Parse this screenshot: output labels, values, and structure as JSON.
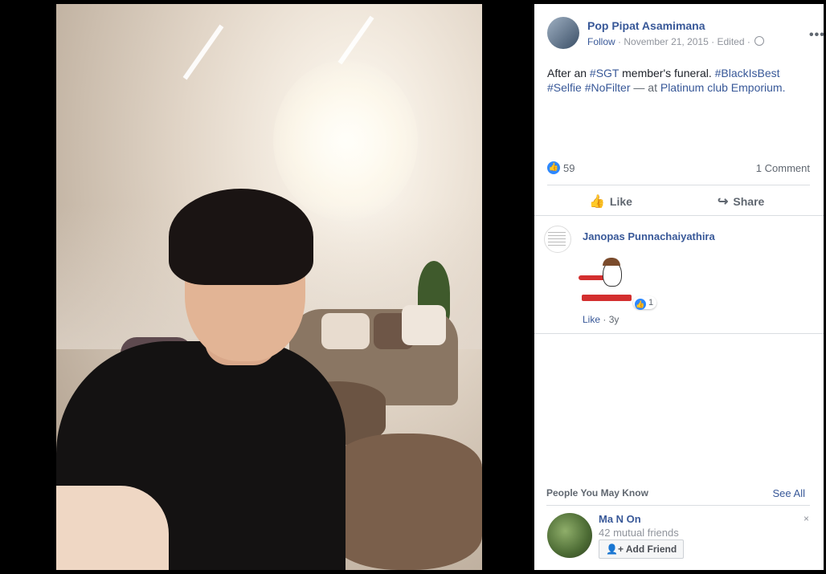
{
  "post": {
    "author": "Pop Pipat Asamimana",
    "follow_label": "Follow",
    "date": "November 21, 2015",
    "edited": "Edited",
    "privacy_icon": "globe-icon",
    "more_label": "•••",
    "caption_prefix": "After an ",
    "tag_sgt": "#SGT",
    "caption_mid": " member's funeral. ",
    "tag_blackisbest": "#BlackIsBest",
    "tag_selfie": "#Selfie",
    "tag_nofilter": "#NoFilter",
    "at_text": " — at ",
    "place": "Platinum club Emporium."
  },
  "reactions": {
    "like_count": "59",
    "comment_count": "1 Comment"
  },
  "actions": {
    "like_label": "Like",
    "share_label": "Share"
  },
  "comment": {
    "author": "Janopas Punnachaiyathira",
    "reaction_count": "1",
    "like_label": "Like",
    "time": "3y"
  },
  "people_you_may_know": {
    "title": "People You May Know",
    "see_all": "See All",
    "suggestion": {
      "name": "Ma N On",
      "mutual": "42 mutual friends",
      "add_friend_label": "Add Friend",
      "dismiss": "×"
    }
  },
  "colors": {
    "link": "#385898",
    "muted": "#90949c",
    "like_blue": "#2d88ff",
    "divider": "#dadde1"
  }
}
